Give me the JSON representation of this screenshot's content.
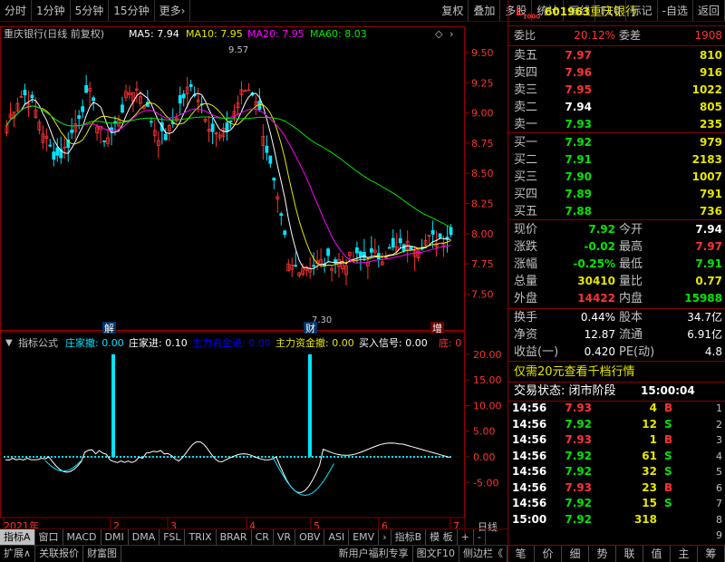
{
  "toolbar": {
    "left": [
      "分时",
      "1分钟",
      "5分钟",
      "15分钟",
      "更多›"
    ],
    "right": [
      "复权",
      "叠加",
      "多股",
      "统计",
      "画线",
      "F10",
      "标记",
      "-自选",
      "返回"
    ]
  },
  "chart": {
    "title": "重庆银行(日线 前复权)",
    "ma_labels": [
      {
        "text": "MA5: 7.94",
        "color": "#ffffff"
      },
      {
        "text": "MA10: 7.95",
        "color": "#e6e600"
      },
      {
        "text": "MA20: 7.95",
        "color": "#ff00ff"
      },
      {
        "text": "MA60: 8.03",
        "color": "#00e600"
      }
    ],
    "price_ticks": [
      "9.50",
      "9.25",
      "9.00",
      "8.75",
      "8.50",
      "8.25",
      "8.00",
      "7.75",
      "7.50"
    ],
    "high_label": "9.57",
    "low_label": "7.30",
    "markers": [
      "解",
      "财",
      "增"
    ],
    "date_axis": [
      "2021年",
      "2",
      "3",
      "4",
      "5",
      "6",
      "7"
    ],
    "daily_label": "日线"
  },
  "indicator": {
    "name": "指标公式",
    "items": [
      {
        "text": "庄家撤: 0.00",
        "color": "#00e5ff"
      },
      {
        "text": "庄家进: 0.10",
        "color": "#ffffff"
      },
      {
        "text": "主力资金进: 0.00",
        "color": "#0000ff"
      },
      {
        "text": "主力资金撤: 0.00",
        "color": "#e6e600"
      },
      {
        "text": "买入信号: 0.00",
        "color": "#ffffff"
      },
      {
        "text": "底: 0",
        "color": "#ff3232"
      }
    ],
    "ticks": [
      "20.00",
      "15.00",
      "10.00",
      "5.00",
      "0.00",
      "-5.00"
    ]
  },
  "tabs": [
    "指标A",
    "窗口",
    "MACD",
    "DMI",
    "DMA",
    "FSL",
    "TRIX",
    "BRAR",
    "CR",
    "VR",
    "OBV",
    "ASI",
    "EMV",
    "›",
    "指标B",
    "模 板",
    "+",
    "-"
  ],
  "statusbar": [
    "扩展∧",
    "关联报价",
    "财富图",
    "新用户福利专享",
    "图文F10",
    "侧边栏《"
  ],
  "quote": {
    "code": "601963",
    "name": "重庆银行",
    "weibi_label": "委比",
    "weibi": "20.12%",
    "weicha_label": "委差",
    "weicha": "1908",
    "asks": [
      {
        "label": "卖五",
        "price": "7.97",
        "vol": "810"
      },
      {
        "label": "卖四",
        "price": "7.96",
        "vol": "916"
      },
      {
        "label": "卖三",
        "price": "7.95",
        "vol": "1022"
      },
      {
        "label": "卖二",
        "price": "7.94",
        "vol": "805"
      },
      {
        "label": "卖一",
        "price": "7.93",
        "vol": "235"
      }
    ],
    "bids": [
      {
        "label": "买一",
        "price": "7.92",
        "vol": "979"
      },
      {
        "label": "买二",
        "price": "7.91",
        "vol": "2183"
      },
      {
        "label": "买三",
        "price": "7.90",
        "vol": "1007"
      },
      {
        "label": "买四",
        "price": "7.89",
        "vol": "791"
      },
      {
        "label": "买五",
        "price": "7.88",
        "vol": "736"
      }
    ],
    "stats": [
      {
        "l1": "现价",
        "v1": "7.92",
        "c1": "green",
        "l2": "今开",
        "v2": "7.94",
        "c2": "white"
      },
      {
        "l1": "涨跌",
        "v1": "-0.02",
        "c1": "green",
        "l2": "最高",
        "v2": "7.97",
        "c2": "red"
      },
      {
        "l1": "涨幅",
        "v1": "-0.25%",
        "c1": "green",
        "l2": "最低",
        "v2": "7.91",
        "c2": "green"
      },
      {
        "l1": "总量",
        "v1": "30410",
        "c1": "yellow",
        "l2": "量比",
        "v2": "0.77",
        "c2": "yellow"
      },
      {
        "l1": "外盘",
        "v1": "14422",
        "c1": "red",
        "l2": "内盘",
        "v2": "15988",
        "c2": "green"
      }
    ],
    "stats2": [
      {
        "l1": "换手",
        "v1": "0.44%",
        "l2": "股本",
        "v2": "34.7亿"
      },
      {
        "l1": "净资",
        "v1": "12.87",
        "l2": "流通",
        "v2": "6.91亿"
      },
      {
        "l1": "收益(一)",
        "v1": "0.420",
        "l2": "PE(动)",
        "v2": "4.8"
      }
    ],
    "promo": "仅需20元查看千档行情",
    "trade_status_label": "交易状态: 闭市阶段",
    "trade_status_time": "15:00:04",
    "ticks": [
      {
        "time": "14:56",
        "price": "7.93",
        "pc": "red",
        "vol": "4",
        "side": "B"
      },
      {
        "time": "14:56",
        "price": "7.92",
        "pc": "green",
        "vol": "12",
        "side": "S"
      },
      {
        "time": "14:56",
        "price": "7.93",
        "pc": "red",
        "vol": "1",
        "side": "B"
      },
      {
        "time": "14:56",
        "price": "7.92",
        "pc": "green",
        "vol": "61",
        "side": "S"
      },
      {
        "time": "14:56",
        "price": "7.92",
        "pc": "green",
        "vol": "32",
        "side": "S"
      },
      {
        "time": "14:56",
        "price": "7.93",
        "pc": "red",
        "vol": "23",
        "side": "B"
      },
      {
        "time": "14:56",
        "price": "7.92",
        "pc": "green",
        "vol": "15",
        "side": "S"
      },
      {
        "time": "15:00",
        "price": "7.92",
        "pc": "green",
        "vol": "318",
        "side": ""
      }
    ],
    "tick_index": [
      "9",
      "8",
      "7",
      "6",
      "5",
      "4",
      "3",
      "2",
      "1"
    ],
    "bottom_tabs": [
      "笔",
      "价",
      "细",
      "势",
      "联",
      "值",
      "主",
      "筹"
    ]
  }
}
